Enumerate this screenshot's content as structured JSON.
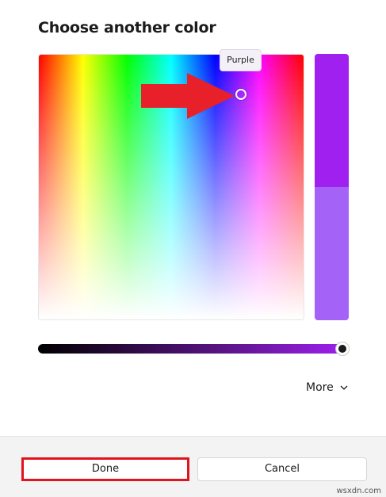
{
  "dialog": {
    "title": "Choose another color"
  },
  "picker": {
    "tooltip": "Purple",
    "selected_color": "#a020f0",
    "previous_color": "#a463f6"
  },
  "brightness_slider": {
    "level": 1.0
  },
  "more_toggle": {
    "label": "More",
    "icon": "chevron-down-icon"
  },
  "footer": {
    "done_label": "Done",
    "cancel_label": "Cancel"
  },
  "annotation": {
    "arrow_color": "#e8202a",
    "highlight_color": "#e0131e"
  },
  "watermark": "wsxdn.com"
}
